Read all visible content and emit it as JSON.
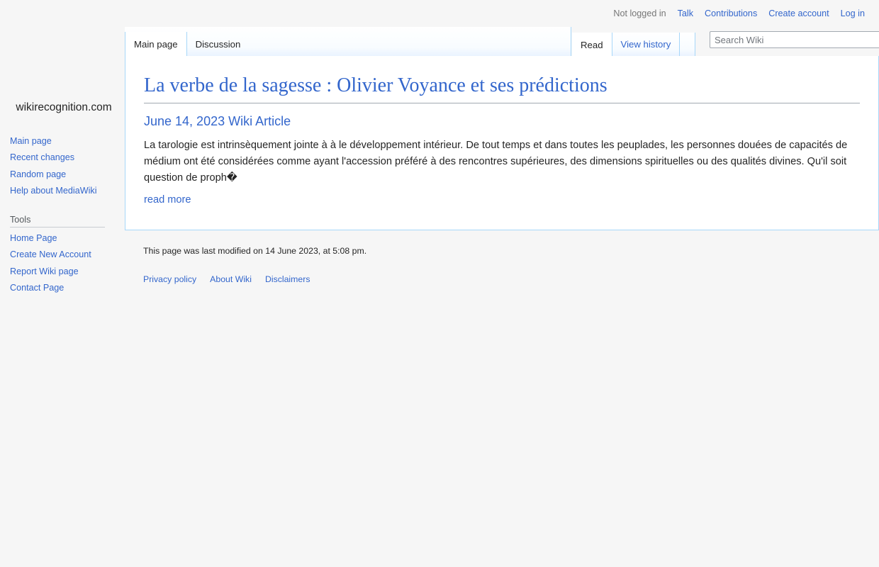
{
  "personal_bar": {
    "status": "Not logged in",
    "links": [
      {
        "label": "Talk"
      },
      {
        "label": "Contributions"
      },
      {
        "label": "Create account"
      },
      {
        "label": "Log in"
      }
    ]
  },
  "namespace_tabs": [
    {
      "label": "Main page",
      "selected": true
    },
    {
      "label": "Discussion",
      "selected": false
    }
  ],
  "view_tabs": [
    {
      "label": "Read",
      "selected": true
    },
    {
      "label": "View history",
      "selected": false
    }
  ],
  "search": {
    "placeholder": "Search Wiki",
    "value": ""
  },
  "sidebar": {
    "logo_text": "wikirecognition.com",
    "navigation": {
      "items": [
        {
          "label": "Main page"
        },
        {
          "label": "Recent changes"
        },
        {
          "label": "Random page"
        },
        {
          "label": "Help about MediaWiki"
        }
      ]
    },
    "tools": {
      "heading": "Tools",
      "items": [
        {
          "label": "Home Page"
        },
        {
          "label": "Create New Account"
        },
        {
          "label": "Report Wiki page"
        },
        {
          "label": "Contact Page"
        }
      ]
    }
  },
  "article": {
    "title": "La verbe de la sagesse : Olivier Voyance et ses prédictions",
    "subtitle": "June 14, 2023 Wiki Article",
    "body": "La tarologie est intrinsèquement jointe à à le développement intérieur. De tout temps et dans toutes les peuplades, les personnes douées de capacités de médium ont été considérées comme ayant l'accession préféré à des rencontres supérieures, des dimensions spirituelles ou des qualités divines. Qu'il soit question de proph�",
    "read_more_label": "read more"
  },
  "footer": {
    "last_modified": "This page was last modified on 14 June 2023, at 5:08 pm.",
    "places": [
      {
        "label": "Privacy policy"
      },
      {
        "label": "About Wiki"
      },
      {
        "label": "Disclaimers"
      }
    ]
  },
  "colors": {
    "link": "#3366cc",
    "tab_border": "#a7d7f9",
    "page_background": "#f6f6f6",
    "text": "#252525"
  }
}
